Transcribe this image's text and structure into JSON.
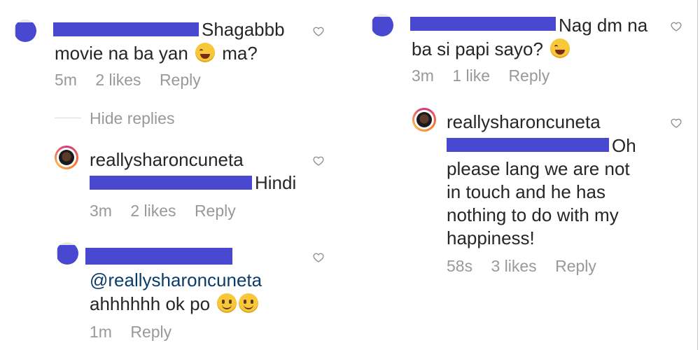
{
  "left_column": {
    "comment1": {
      "line1_text": "Shagabbb",
      "line2_text_a": "movie na ba yan",
      "line2_text_b": "ma?",
      "emoji1": "laughing-tears-emoji",
      "time": "5m",
      "likes": "2 likes",
      "reply": "Reply"
    },
    "hide_replies": "Hide replies",
    "reply1": {
      "username": "reallysharoncuneta",
      "text": "Hindi",
      "time": "3m",
      "likes": "2 likes",
      "reply": "Reply"
    },
    "reply2": {
      "mention": "@reallysharoncuneta",
      "text": "ahhhhhh ok po",
      "emojis": [
        "slight-smile-emoji",
        "blush-emoji"
      ],
      "time": "1m",
      "reply": "Reply"
    }
  },
  "right_column": {
    "comment2": {
      "line1_text": "Nag dm na",
      "line2_text": "ba si papi sayo?",
      "emoji": "laughing-tears-emoji",
      "time": "3m",
      "likes": "1 like",
      "reply": "Reply"
    },
    "reply3": {
      "username": "reallysharoncuneta",
      "text_line1": "Oh",
      "text_line2": "please lang we are not",
      "text_line3": "in touch and he has",
      "text_line4": "nothing to do with my",
      "text_line5": "happiness!",
      "time": "58s",
      "likes": "3 likes",
      "reply": "Reply"
    }
  },
  "colors": {
    "text": "#262626",
    "meta": "#999999",
    "redaction": "#4848d0",
    "mention": "#0b3d6b"
  }
}
